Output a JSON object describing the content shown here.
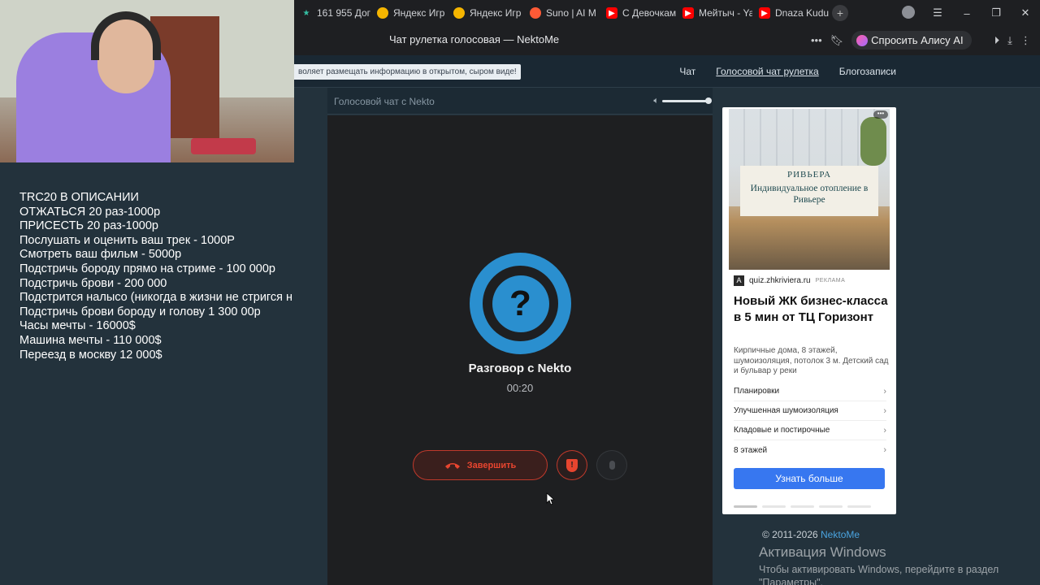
{
  "browser": {
    "tabs": [
      {
        "label": "161 955 Дог",
        "icon": "star-icon",
        "color": "#35c0a4"
      },
      {
        "label": "Яндекс Игр",
        "icon": "game-face-icon",
        "color": "#f5b500"
      },
      {
        "label": "Яндекс Игр",
        "icon": "game-face-icon",
        "color": "#f5b500"
      },
      {
        "label": "Suno | AI M",
        "icon": "suno-icon",
        "color": "#ff5a36"
      },
      {
        "label": "С Девочкам",
        "icon": "youtube-icon",
        "color": "#ff0000"
      },
      {
        "label": "Мейтыч - Ya",
        "icon": "youtube-icon",
        "color": "#ff0000"
      },
      {
        "label": "Dnaza Kudu",
        "icon": "youtube-icon",
        "color": "#ff0000"
      }
    ],
    "page_title": "Чат рулетка голосовая — NektoMe",
    "alisa_button": "Спросить Алису AI"
  },
  "site": {
    "notice": "воляет размещать информацию в открытом, сыром виде!",
    "nav": [
      "Чат",
      "Голосовой чат рулетка",
      "Блогозаписи"
    ]
  },
  "overlay_lines": [
    "TRC20 В ОПИСАНИИ",
    "ОТЖАТЬСЯ 20 раз-1000р",
    "ПРИСЕСТЬ 20 раз-1000р",
    "Послушать и оценить ваш трек - 1000Р",
    "Смотреть ваш фильм - 5000р",
    "Подстричь бороду прямо на стриме - 100 000р",
    "Подстричь брови - 200 000",
    "Подстрится налысо (никогда в жизни не стригся н",
    "Подстричь брови бороду и голову 1 300 00р",
    "Часы мечты - 16000$",
    "Машина мечты - 110 000$",
    "Переезд в москву 12 000$"
  ],
  "chat": {
    "header_title": "Голосовой чат с Nekto",
    "conversation_title": "Разговор с Nekto",
    "timer": "00:20",
    "end_label": "Завершить"
  },
  "ad": {
    "image_brand": "РИВЬЕРА",
    "image_slogan": "Индивидуальное отопление в Ривьере",
    "domain": "quiz.zhkriviera.ru",
    "tag": "РЕКЛАМА",
    "title": "Новый ЖК бизнес-класса в 5 мин от ТЦ Горизонт",
    "desc": "Кирпичные дома, 8 этажей, шумоизоляция, потолок 3 м. Детский сад и бульвар у реки",
    "links": [
      "Планировки",
      "Улучшенная шумоизоляция",
      "Кладовые и постирочные",
      "8 этажей"
    ],
    "cta": "Узнать больше"
  },
  "footer": {
    "copyright": "© 2011-2026",
    "link": "NektoMe"
  },
  "windows_activation": {
    "title": "Активация Windows",
    "subtitle": "Чтобы активировать Windows, перейдите в раздел \"Параметры\"."
  }
}
